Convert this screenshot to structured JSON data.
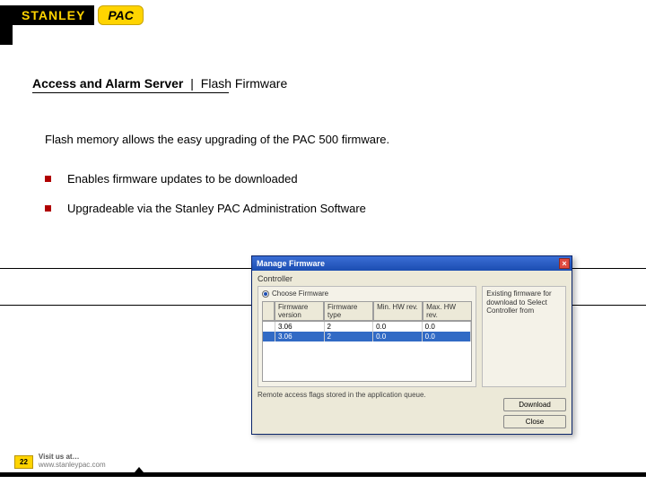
{
  "brand": {
    "stanley": "STANLEY",
    "pac": "PAC"
  },
  "title": {
    "bold": "Access and Alarm Server",
    "divider": "|",
    "sub": "Flash Firmware"
  },
  "intro": "Flash memory allows the easy upgrading of the PAC 500 firmware.",
  "bullets": [
    "Enables firmware updates to be downloaded",
    "Upgradeable via the Stanley PAC Administration Software"
  ],
  "dialog": {
    "title": "Manage Firmware",
    "section": "Controller",
    "radio": "Choose Firmware",
    "sidehelp": "Existing firmware for download to Select Controller from",
    "columns": [
      "",
      "Firmware version",
      "Firmware type",
      "Min. HW rev.",
      "Max. HW rev."
    ],
    "rows": [
      {
        "sel": false,
        "cells": [
          "",
          "3.06",
          "2",
          "0.0",
          "0.0"
        ]
      },
      {
        "sel": true,
        "cells": [
          "",
          "3.06",
          "2",
          "0.0",
          "0.0"
        ]
      }
    ],
    "hint": "Remote access flags stored in the application queue.",
    "buttons": {
      "download": "Download",
      "close": "Close"
    }
  },
  "footer": {
    "slide": "22",
    "l1": "Visit us at…",
    "l2": "www.stanleypac.com"
  }
}
